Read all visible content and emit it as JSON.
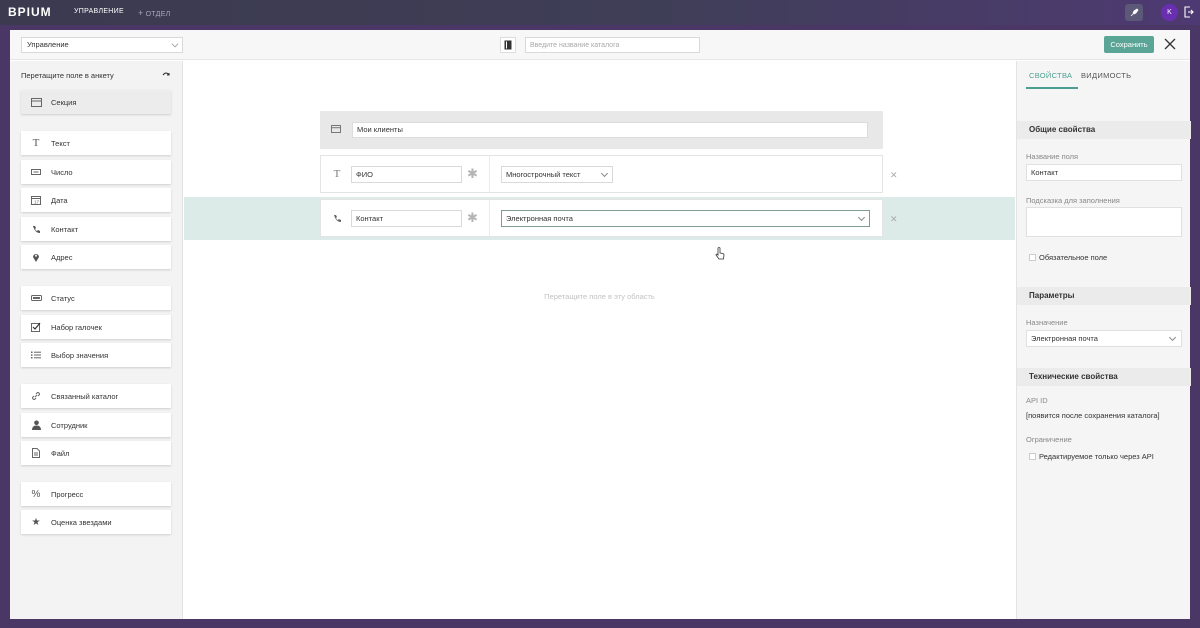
{
  "topbar": {
    "logo": "BPIUM",
    "nav_main": "УПРАВЛЕНИЕ",
    "nav_add": "ОТДЕЛ",
    "avatar_letter": "K",
    "accent": "#6a2fb0"
  },
  "toolbar": {
    "section_select": "Управление",
    "catalog_placeholder": "Введите название каталога",
    "save_label": "Сохранить",
    "save_color": "#5aa596"
  },
  "palette": {
    "title": "Перетащите поле в анкету",
    "items": [
      {
        "label": "Секция",
        "icon": "section-icon"
      },
      {
        "label": "Текст",
        "icon": "text-icon"
      },
      {
        "label": "Число",
        "icon": "number-icon"
      },
      {
        "label": "Дата",
        "icon": "calendar-icon"
      },
      {
        "label": "Контакт",
        "icon": "phone-icon"
      },
      {
        "label": "Адрес",
        "icon": "map-pin-icon"
      },
      {
        "label": "Статус",
        "icon": "status-icon"
      },
      {
        "label": "Набор галочек",
        "icon": "checkbox-icon"
      },
      {
        "label": "Выбор значения",
        "icon": "list-icon"
      },
      {
        "label": "Связанный каталог",
        "icon": "link-icon"
      },
      {
        "label": "Сотрудник",
        "icon": "user-icon"
      },
      {
        "label": "Файл",
        "icon": "file-icon"
      },
      {
        "label": "Прогресс",
        "icon": "percent-icon"
      },
      {
        "label": "Оценка звездами",
        "icon": "star-icon"
      }
    ]
  },
  "form": {
    "section_title": "Мои клиенты",
    "fields": [
      {
        "name": "ФИО",
        "type": "Многострочный текст",
        "icon": "text-icon"
      },
      {
        "name": "Контакт",
        "type": "Электронная почта",
        "icon": "phone-icon"
      }
    ],
    "drop_hint": "Перетащите поле в эту область"
  },
  "properties": {
    "tabs": [
      "СВОЙСТВА",
      "ВИДИМОСТЬ"
    ],
    "general_title": "Общие свойства",
    "field_name_label": "Название поля",
    "field_name_value": "Контакт",
    "hint_label": "Подсказка для заполнения",
    "hint_value": "",
    "required_label": "Обязательное поле",
    "params_title": "Параметры",
    "purpose_label": "Назначение",
    "purpose_value": "Электронная почта",
    "tech_title": "Технические свойства",
    "api_id_label": "API ID",
    "api_id_value": "[появится после сохранения каталога]",
    "restriction_label": "Ограничение",
    "api_only_label": "Редактируемое только через API"
  }
}
